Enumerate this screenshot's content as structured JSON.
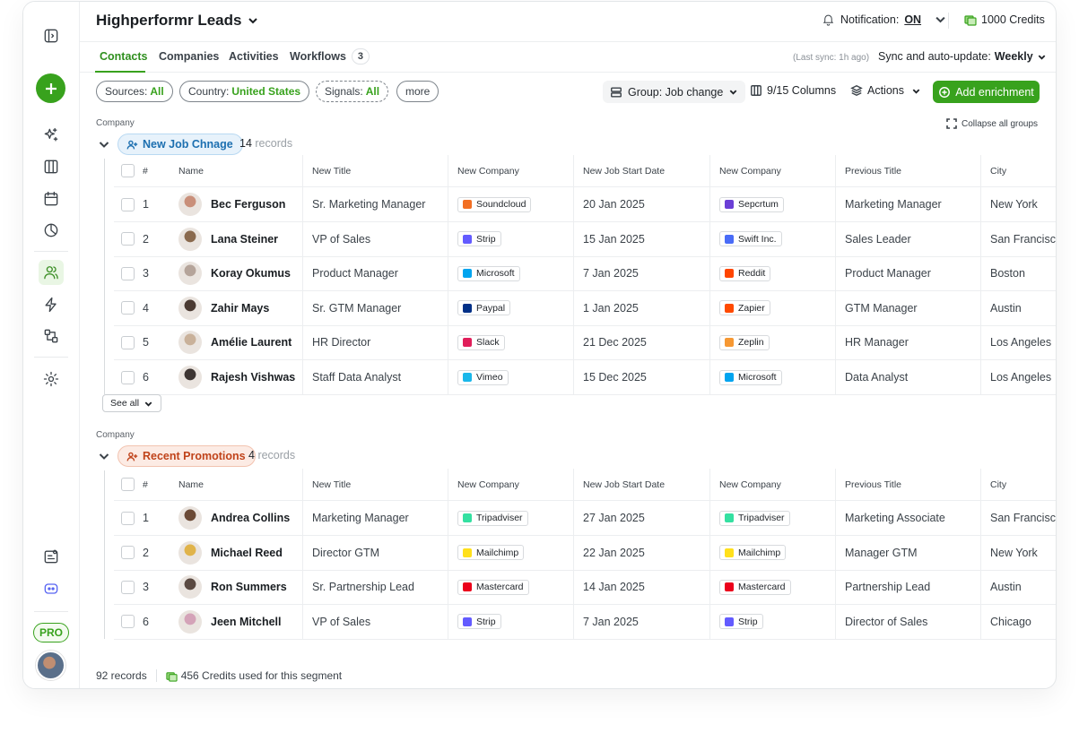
{
  "header": {
    "title": "Highperformr Leads",
    "notification_label": "Notification:",
    "notification_state": "ON",
    "credits": "1000 Credits"
  },
  "tabs": [
    {
      "label": "Contacts"
    },
    {
      "label": "Companies"
    },
    {
      "label": "Activities"
    },
    {
      "label": "Workflows",
      "count": "3"
    }
  ],
  "sync": {
    "last": "(Last sync: 1h ago)",
    "label": "Sync and auto-update:",
    "value": "Weekly"
  },
  "filters": [
    {
      "label": "Sources:",
      "value": "All"
    },
    {
      "label": "Country:",
      "value": "United States"
    },
    {
      "label": "Signals:",
      "value": "All"
    },
    {
      "label": "more",
      "value": ""
    }
  ],
  "toolbar": {
    "group_by": "Group: Job change",
    "columns": "9/15 Columns",
    "actions": "Actions",
    "add": "Add enrichment"
  },
  "collapse_label": "Collapse all groups",
  "group_caption": "Company",
  "columns": [
    "#",
    "Name",
    "New Title",
    "New Company",
    "New Job Start Date",
    "New Company",
    "Previous Title",
    "City"
  ],
  "groups": [
    {
      "name": "New Job Chnage",
      "count": "14",
      "count_label": "records",
      "color": "#1c6fb0",
      "rows": [
        {
          "num": "1",
          "name": "Bec Ferguson",
          "title": "Sr. Marketing Manager",
          "company": "Soundcloud",
          "company_icon": "soundcloud-logo",
          "company_color": "#f26f23",
          "start": "20 Jan 2025",
          "new_company": "Sepcrtum",
          "new_company_icon": "spectrum-logo",
          "new_company_color": "#6b3fd6",
          "prev_title": "Marketing Manager",
          "city": "New York",
          "avatar_color": "#c98f7a"
        },
        {
          "num": "2",
          "name": "Lana Steiner",
          "title": "VP of Sales",
          "company": "Strip",
          "company_icon": "stripe-logo",
          "company_color": "#635bff",
          "start": "15 Jan 2025",
          "new_company": "Swift Inc.",
          "new_company_icon": "swift-logo",
          "new_company_color": "#4a6cf7",
          "prev_title": "Sales Leader",
          "city": "San Francisco",
          "avatar_color": "#8a6a4e"
        },
        {
          "num": "3",
          "name": "Koray Okumus",
          "title": "Product Manager",
          "company": "Microsoft",
          "company_icon": "microsoft-logo",
          "company_color": "#00a4ef",
          "start": "7 Jan 2025",
          "new_company": "Reddit",
          "new_company_icon": "reddit-logo",
          "new_company_color": "#ff4500",
          "prev_title": "Product Manager",
          "city": "Boston",
          "avatar_color": "#b5a49a"
        },
        {
          "num": "4",
          "name": "Zahir Mays",
          "title": "Sr. GTM Manager",
          "company": "Paypal",
          "company_icon": "paypal-logo",
          "company_color": "#003087",
          "start": "1 Jan 2025",
          "new_company": "Zapier",
          "new_company_icon": "zapier-logo",
          "new_company_color": "#ff4a00",
          "prev_title": "GTM Manager",
          "city": "Austin",
          "avatar_color": "#4b3a32"
        },
        {
          "num": "5",
          "name": "Amélie Laurent",
          "title": "HR Director",
          "company": "Slack",
          "company_icon": "slack-logo",
          "company_color": "#e01e5a",
          "start": "21 Dec 2025",
          "new_company": "Zeplin",
          "new_company_icon": "zeplin-logo",
          "new_company_color": "#f69833",
          "prev_title": "HR Manager",
          "city": "Los Angeles",
          "avatar_color": "#c9b19a"
        },
        {
          "num": "6",
          "name": "Rajesh Vishwas",
          "title": "Staff Data Analyst",
          "company": "Vimeo",
          "company_icon": "vimeo-logo",
          "company_color": "#1ab7ea",
          "start": "15 Dec 2025",
          "new_company": "Microsoft",
          "new_company_icon": "microsoft-logo",
          "new_company_color": "#00a4ef",
          "prev_title": "Data Analyst",
          "city": "Los Angeles",
          "avatar_color": "#3d3532"
        }
      ]
    },
    {
      "name": "Recent Promotions",
      "count": "4",
      "count_label": "records",
      "color": "#c0431a",
      "rows": [
        {
          "num": "1",
          "name": "Andrea Collins",
          "title": "Marketing Manager",
          "company": "Tripadviser",
          "company_icon": "tripadvisor-logo",
          "company_color": "#34e0a1",
          "start": "27 Jan 2025",
          "new_company": "Tripadviser",
          "new_company_icon": "tripadvisor-logo",
          "new_company_color": "#34e0a1",
          "prev_title": "Marketing Associate",
          "city": "San Francisco",
          "avatar_color": "#6b4a36"
        },
        {
          "num": "2",
          "name": "Michael Reed",
          "title": "Director GTM",
          "company": "Mailchimp",
          "company_icon": "mailchimp-logo",
          "company_color": "#ffe01b",
          "start": "22 Jan 2025",
          "new_company": "Mailchimp",
          "new_company_icon": "mailchimp-logo",
          "new_company_color": "#ffe01b",
          "prev_title": "Manager GTM",
          "city": "New York",
          "avatar_color": "#e0b34a"
        },
        {
          "num": "3",
          "name": "Ron Summers",
          "title": "Sr. Partnership Lead",
          "company": "Mastercard",
          "company_icon": "mastercard-logo",
          "company_color": "#eb001b",
          "start": "14 Jan 2025",
          "new_company": "Mastercard",
          "new_company_icon": "mastercard-logo",
          "new_company_color": "#eb001b",
          "prev_title": "Partnership Lead",
          "city": "Austin",
          "avatar_color": "#5b4a42"
        },
        {
          "num": "6",
          "name": "Jeen Mitchell",
          "title": "VP of Sales",
          "company": "Strip",
          "company_icon": "stripe-logo",
          "company_color": "#635bff",
          "start": "7 Jan 2025",
          "new_company": "Strip",
          "new_company_icon": "stripe-logo",
          "new_company_color": "#635bff",
          "prev_title": "Director of Sales",
          "city": "Chicago",
          "avatar_color": "#d4a3b8"
        }
      ]
    }
  ],
  "see_all": "See all",
  "footer": {
    "records": "92 records",
    "credits": "456 Credits used for this segment"
  },
  "sidebar": {
    "pro": "PRO"
  },
  "colors": {
    "accent": "#38a21d",
    "blue": "#1c6fb0",
    "orange": "#c0431a"
  }
}
